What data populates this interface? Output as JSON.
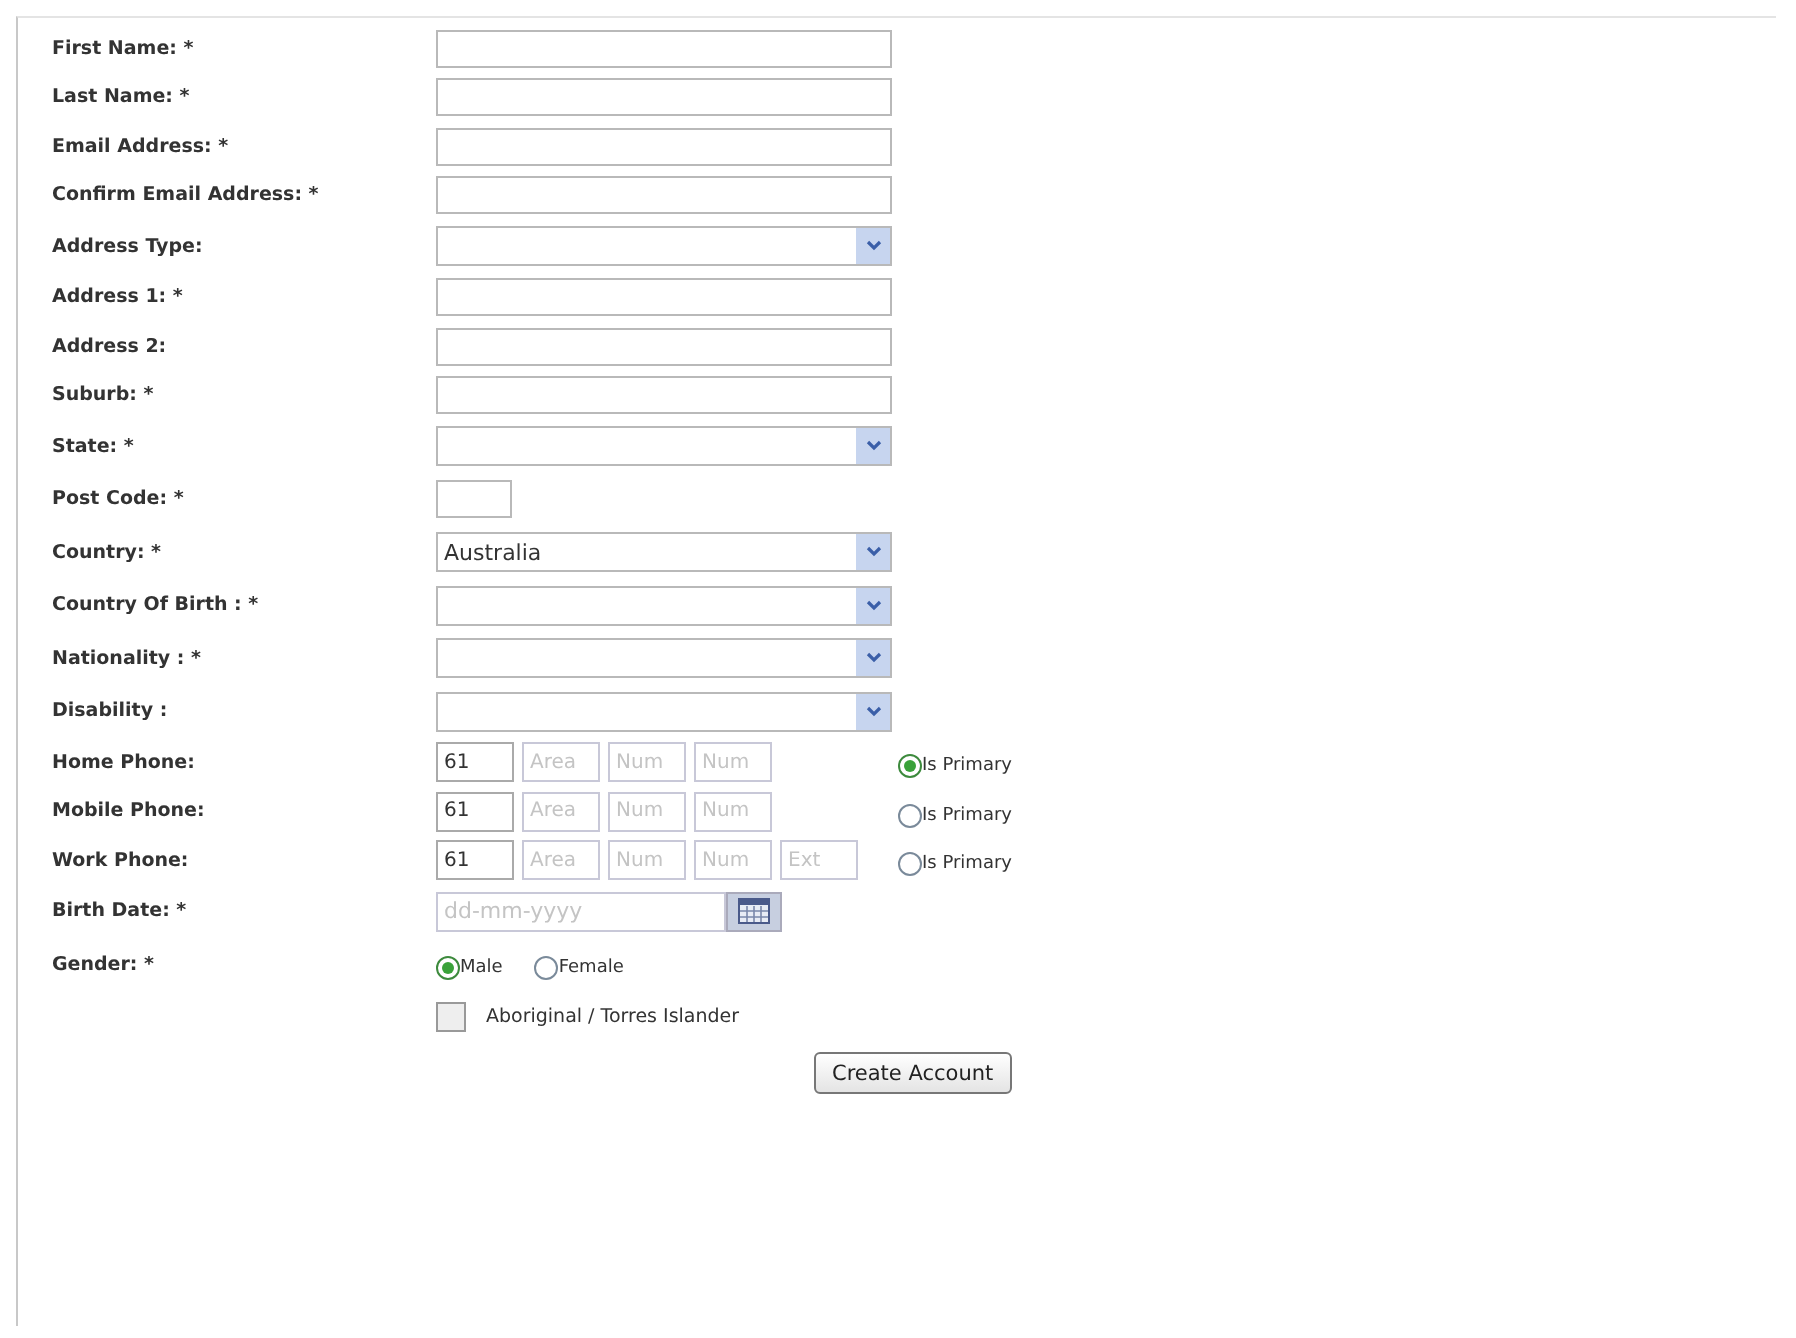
{
  "form": {
    "fields": [
      {
        "kind": "text",
        "label": "First Name: *"
      },
      {
        "kind": "text",
        "label": "Last Name: *"
      },
      {
        "kind": "text",
        "label": "Email Address: *"
      },
      {
        "kind": "text",
        "label": "Confirm Email Address: *"
      },
      {
        "kind": "select",
        "label": "Address Type:"
      },
      {
        "kind": "text",
        "label": "Address 1: *"
      },
      {
        "kind": "text",
        "label": "Address 2:"
      },
      {
        "kind": "text",
        "label": "Suburb: *"
      },
      {
        "kind": "select",
        "label": "State: *"
      },
      {
        "kind": "short",
        "label": "Post Code: *"
      },
      {
        "kind": "select",
        "label": "Country: *",
        "value": "Australia"
      },
      {
        "kind": "select",
        "label": "Country Of Birth : *"
      },
      {
        "kind": "select",
        "label": "Nationality : *"
      },
      {
        "kind": "select",
        "label": "Disability :"
      },
      {
        "kind": "phone",
        "label": "Home Phone:",
        "parts": [
          {
            "value": "61"
          },
          {
            "placeholder": "Area"
          },
          {
            "placeholder": "Num"
          },
          {
            "placeholder": "Num"
          }
        ],
        "primary": {
          "label": "Is Primary",
          "selected": true
        }
      },
      {
        "kind": "phone",
        "label": "Mobile Phone:",
        "parts": [
          {
            "value": "61"
          },
          {
            "placeholder": "Area"
          },
          {
            "placeholder": "Num"
          },
          {
            "placeholder": "Num"
          }
        ],
        "primary": {
          "label": "Is Primary",
          "selected": false
        }
      },
      {
        "kind": "phone",
        "label": "Work Phone:",
        "parts": [
          {
            "value": "61"
          },
          {
            "placeholder": "Area"
          },
          {
            "placeholder": "Num"
          },
          {
            "placeholder": "Num"
          },
          {
            "placeholder": "Ext"
          }
        ],
        "primary": {
          "label": "Is Primary",
          "selected": false
        }
      },
      {
        "kind": "date",
        "label": "Birth Date: *",
        "placeholder": "dd-mm-yyyy"
      },
      {
        "kind": "radios",
        "label": "Gender: *",
        "options": [
          {
            "label": "Male",
            "selected": true
          },
          {
            "label": "Female",
            "selected": false
          }
        ]
      },
      {
        "kind": "checkbox",
        "text": "Aboriginal / Torres Islander",
        "checked": false
      }
    ],
    "submit": "Create Account"
  }
}
